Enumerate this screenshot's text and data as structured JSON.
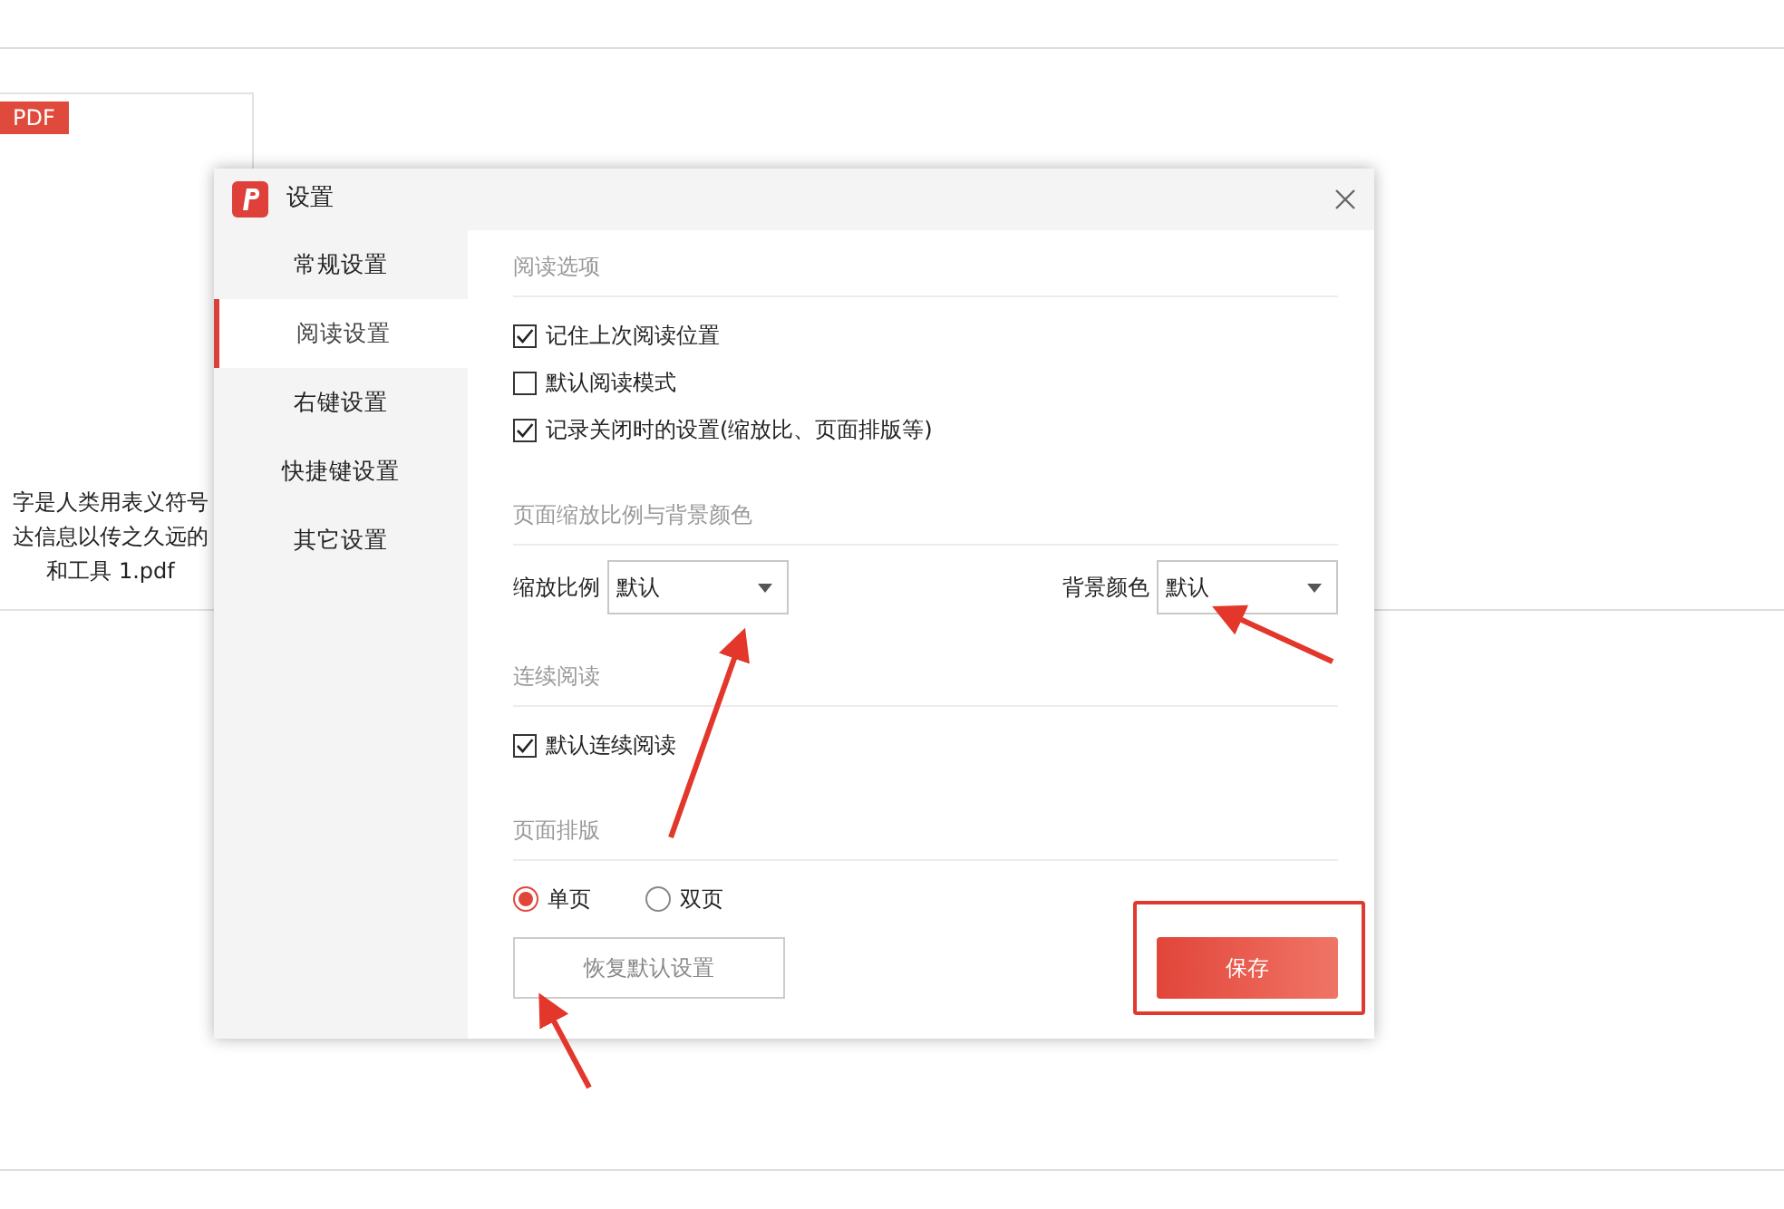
{
  "file_card": {
    "badge": "PDF",
    "caption_lines": [
      "字是人类用表义符号",
      "达信息以传之久远的",
      "和工具 1.pdf"
    ]
  },
  "dialog": {
    "title": "设置",
    "sidebar": [
      {
        "label": "常规设置",
        "selected": false
      },
      {
        "label": "阅读设置",
        "selected": true
      },
      {
        "label": "右键设置",
        "selected": false
      },
      {
        "label": "快捷键设置",
        "selected": false
      },
      {
        "label": "其它设置",
        "selected": false
      }
    ],
    "sections": [
      {
        "kind": "checkboxes",
        "title": "阅读选项",
        "items": [
          {
            "label": "记住上次阅读位置",
            "checked": true
          },
          {
            "label": "默认阅读模式",
            "checked": false
          },
          {
            "label": "记录关闭时的设置(缩放比、页面排版等)",
            "checked": true
          }
        ]
      },
      {
        "kind": "selects",
        "title": "页面缩放比例与背景颜色",
        "fields": [
          {
            "label": "缩放比例",
            "value": "默认"
          },
          {
            "label": "背景颜色",
            "value": "默认"
          }
        ]
      },
      {
        "kind": "checkboxes",
        "title": "连续阅读",
        "items": [
          {
            "label": "默认连续阅读",
            "checked": true
          }
        ]
      },
      {
        "kind": "radios",
        "title": "页面排版",
        "options": [
          {
            "label": "单页",
            "selected": true
          },
          {
            "label": "双页",
            "selected": false
          }
        ]
      }
    ],
    "reset_button": "恢复默认设置",
    "save_button": "保存"
  }
}
